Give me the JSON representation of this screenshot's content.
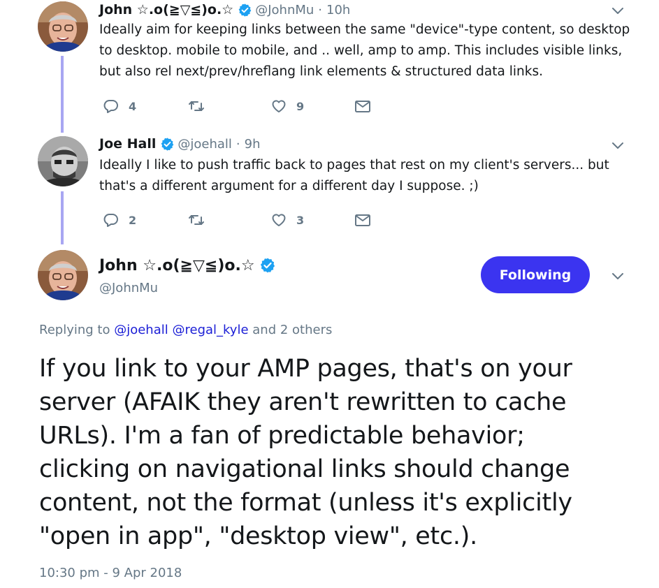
{
  "tweet1": {
    "name": "John ☆.o(≧▽≦)o.☆",
    "handle": "@JohnMu",
    "sep": "·",
    "time": "10h",
    "text_lines": [
      "Ideally aim for keeping links between the same \"device\"-type content, so desktop",
      "to desktop. mobile to mobile, and .. well, amp to amp. This includes visible links,",
      "but also rel next/prev/hreflang link elements & structured data links."
    ],
    "replies": "4",
    "likes": "9"
  },
  "tweet2": {
    "name": "Joe Hall",
    "handle": "@joehall",
    "sep": "·",
    "time": "9h",
    "text_lines": [
      "Ideally I like to push traffic back to pages that rest on my client's servers... but",
      "that's a different argument for a different day I suppose. ;)"
    ],
    "replies": "2",
    "likes": "3"
  },
  "main": {
    "name": "John ☆.o(≧▽≦)o.☆",
    "handle": "@JohnMu",
    "follow_label": "Following",
    "replying_prefix": "Replying to",
    "replying_users": [
      "@joehall",
      "@regal_kyle"
    ],
    "replying_suffix": "and 2 others",
    "text_lines": [
      "If you link to your AMP pages, that's on your",
      "server (AFAIK they aren't rewritten to cache",
      "URLs). I'm a fan of predictable behavior;",
      "clicking on navigational links should change",
      "content, not the format (unless it's explicitly",
      "\"open in app\", \"desktop view\", etc.)."
    ],
    "timestamp": "10:30 pm - 9 Apr 2018"
  },
  "icons": {
    "reply": "reply-icon",
    "retweet": "retweet-icon",
    "like": "heart-icon",
    "dm": "envelope-icon",
    "verified": "verified-badge-icon",
    "more": "chevron-down-icon"
  },
  "colors": {
    "thread_line": "#a8a6f2",
    "follow_button": "#3b34f0",
    "link": "#1b1ed6",
    "muted": "#657786",
    "verified": "#1da1f2"
  }
}
